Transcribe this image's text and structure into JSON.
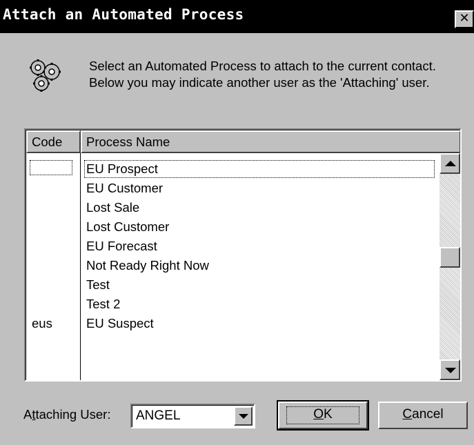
{
  "dialog": {
    "title": "Attach an Automated Process",
    "close_glyph": "✕",
    "icon": "gears-icon",
    "description": "Select an Automated Process to attach to the current contact.  Below you may indicate another user as the 'Attaching' user."
  },
  "list": {
    "columns": [
      "Code",
      "Process Name"
    ],
    "rows": [
      {
        "code": "",
        "name": "EU Prospect"
      },
      {
        "code": "",
        "name": "EU Customer"
      },
      {
        "code": "",
        "name": "Lost Sale"
      },
      {
        "code": "",
        "name": "Lost Customer"
      },
      {
        "code": "",
        "name": "EU Forecast"
      },
      {
        "code": "",
        "name": "Not Ready Right Now"
      },
      {
        "code": "",
        "name": "Test"
      },
      {
        "code": "",
        "name": "Test 2"
      },
      {
        "code": "eus",
        "name": "EU Suspect"
      }
    ]
  },
  "footer": {
    "user_label_pre": "A",
    "user_label_ul": "t",
    "user_label_post": "taching User:",
    "user_value": "ANGEL",
    "ok_ul": "O",
    "ok_post": "K",
    "cancel_ul": "C",
    "cancel_post": "ancel"
  },
  "colors": {
    "face": "#c0c0c0",
    "titlebar": "#000000",
    "title_text": "#ffffff",
    "window": "#ffffff"
  }
}
